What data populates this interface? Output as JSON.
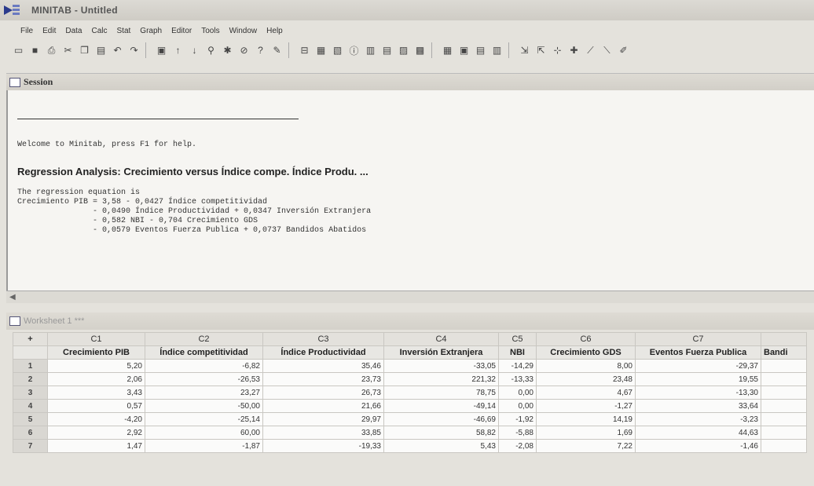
{
  "window": {
    "title": "MINITAB - Untitled"
  },
  "menu": [
    "File",
    "Edit",
    "Data",
    "Calc",
    "Stat",
    "Graph",
    "Editor",
    "Tools",
    "Window",
    "Help"
  ],
  "session": {
    "title": "Session",
    "welcome": "Welcome to Minitab, press F1 for help.",
    "heading": "Regression Analysis: Crecimiento  versus Índice compe. Índice Produ. ...",
    "equation_label": "The regression equation is",
    "equation_lines": [
      "Crecimiento PIB = 3,58 - 0,0427 Índice competitividad",
      "                - 0,0490 Índice Productividad + 0,0347 Inversión Extranjera",
      "                - 0,582 NBI - 0,704 Crecimiento GDS",
      "                - 0,0579 Eventos Fuerza Publica + 0,0737 Bandidos Abatidos"
    ]
  },
  "worksheet": {
    "title": "Worksheet 1 ***",
    "corner": "+",
    "col_ids": [
      "C1",
      "C2",
      "C3",
      "C4",
      "C5",
      "C6",
      "C7",
      ""
    ],
    "col_names": [
      "Crecimiento PIB",
      "Índice competitividad",
      "Índice Productividad",
      "Inversión Extranjera",
      "NBI",
      "Crecimiento GDS",
      "Eventos Fuerza Publica",
      "Bandi"
    ],
    "rows": [
      {
        "n": "1",
        "v": [
          "5,20",
          "-6,82",
          "35,46",
          "-33,05",
          "-14,29",
          "8,00",
          "-29,37",
          ""
        ]
      },
      {
        "n": "2",
        "v": [
          "2,06",
          "-26,53",
          "23,73",
          "221,32",
          "-13,33",
          "23,48",
          "19,55",
          ""
        ]
      },
      {
        "n": "3",
        "v": [
          "3,43",
          "23,27",
          "26,73",
          "78,75",
          "0,00",
          "4,67",
          "-13,30",
          ""
        ]
      },
      {
        "n": "4",
        "v": [
          "0,57",
          "-50,00",
          "21,66",
          "-49,14",
          "0,00",
          "-1,27",
          "33,64",
          ""
        ]
      },
      {
        "n": "5",
        "v": [
          "-4,20",
          "-25,14",
          "29,97",
          "-46,69",
          "-1,92",
          "14,19",
          "-3,23",
          ""
        ]
      },
      {
        "n": "6",
        "v": [
          "2,92",
          "60,00",
          "33,85",
          "58,82",
          "-5,88",
          "1,69",
          "44,63",
          ""
        ]
      },
      {
        "n": "7",
        "v": [
          "1,47",
          "-1,87",
          "-19,33",
          "5,43",
          "-2,08",
          "7,22",
          "-1,46",
          ""
        ]
      }
    ]
  }
}
